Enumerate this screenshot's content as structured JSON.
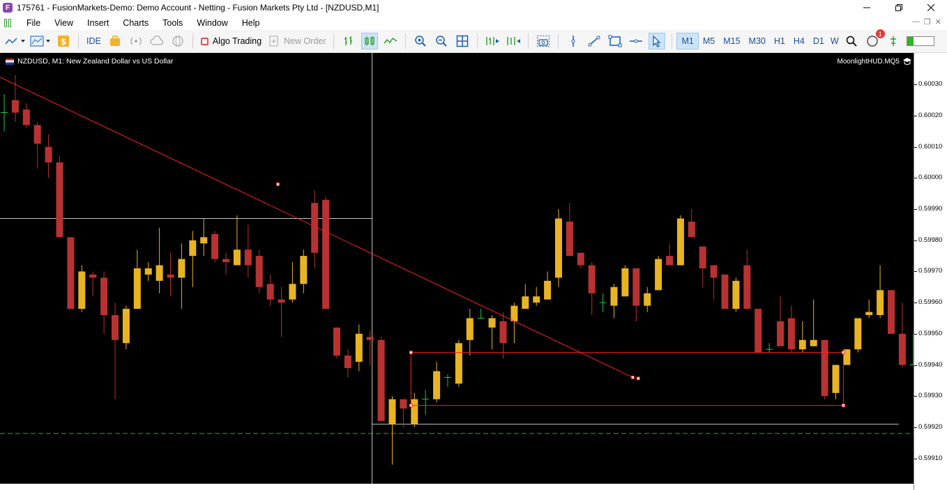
{
  "window": {
    "title": "175761 - FusionMarkets-Demo: Demo Account - Netting - Fusion Markets Pty Ltd - [NZDUSD,M1]",
    "app_icon": "F"
  },
  "menu": [
    "File",
    "View",
    "Insert",
    "Charts",
    "Tools",
    "Window",
    "Help"
  ],
  "toolbar": {
    "ide_label": "IDE",
    "algo_trading_label": "Algo Trading",
    "new_order_label": "New Order",
    "timeframes": [
      "M1",
      "M5",
      "M15",
      "M30",
      "H1",
      "H4",
      "D1",
      "W"
    ],
    "active_timeframe": "M1",
    "notifications": "1",
    "level": 0.25
  },
  "chart": {
    "header": "NZDUSD, M1:  New Zealand Dollar vs US Dollar",
    "indicator": "MoonlightHUD.MQ5",
    "colors": {
      "bull": "#e8b422",
      "bear": "#b83232",
      "doji": "#22c84a",
      "trendline": "#ff2020",
      "bid_line": "#2fa82f",
      "crosshair": "#c8c8c8"
    }
  },
  "chart_data": {
    "type": "candlestick",
    "symbol": "NZDUSD",
    "timeframe": "M1",
    "ylim": [
      0.59905,
      0.60037
    ],
    "y_ticks": [
      "0.60030",
      "0.60020",
      "0.60010",
      "0.60000",
      "0.59990",
      "0.59980",
      "0.59970",
      "0.59960",
      "0.59950",
      "0.59940",
      "0.59930",
      "0.59920",
      "0.59910"
    ],
    "candles": [
      [
        0.60021,
        0.60027,
        0.60015,
        0.60021
      ],
      [
        0.60025,
        0.60033,
        0.60018,
        0.60021
      ],
      [
        0.60022,
        0.60024,
        0.60016,
        0.60017
      ],
      [
        0.60017,
        0.60018,
        0.60003,
        0.60011
      ],
      [
        0.6001,
        0.60014,
        0.6,
        0.60005
      ],
      [
        0.60005,
        0.60007,
        0.59981,
        0.59981
      ],
      [
        0.59981,
        0.59977,
        0.59958,
        0.59958
      ],
      [
        0.59958,
        0.59972,
        0.59957,
        0.5997
      ],
      [
        0.59969,
        0.5997,
        0.59962,
        0.59968
      ],
      [
        0.59968,
        0.5997,
        0.5995,
        0.59956
      ],
      [
        0.59956,
        0.5996,
        0.59929,
        0.59948
      ],
      [
        0.59947,
        0.59959,
        0.59945,
        0.59958
      ],
      [
        0.59958,
        0.59977,
        0.59958,
        0.59971
      ],
      [
        0.59969,
        0.59973,
        0.59967,
        0.59971
      ],
      [
        0.59967,
        0.59984,
        0.59963,
        0.59972
      ],
      [
        0.59969,
        0.59976,
        0.59962,
        0.59968
      ],
      [
        0.59968,
        0.59979,
        0.59958,
        0.59974
      ],
      [
        0.59975,
        0.59983,
        0.59965,
        0.5998
      ],
      [
        0.59979,
        0.59987,
        0.59975,
        0.59981
      ],
      [
        0.59982,
        0.59983,
        0.59973,
        0.59974
      ],
      [
        0.59974,
        0.59976,
        0.59969,
        0.59973
      ],
      [
        0.59972,
        0.59988,
        0.59972,
        0.59977
      ],
      [
        0.59977,
        0.59985,
        0.59968,
        0.59972
      ],
      [
        0.59975,
        0.59977,
        0.59963,
        0.59965
      ],
      [
        0.59966,
        0.59969,
        0.59959,
        0.59961
      ],
      [
        0.59961,
        0.59965,
        0.59949,
        0.5996
      ],
      [
        0.59961,
        0.59973,
        0.5996,
        0.59966
      ],
      [
        0.59966,
        0.59977,
        0.59963,
        0.59975
      ],
      [
        0.59992,
        0.59996,
        0.59971,
        0.59976
      ],
      [
        0.59993,
        0.59994,
        0.59958,
        0.59958
      ],
      [
        0.59952,
        0.59951,
        0.59942,
        0.59943
      ],
      [
        0.59943,
        0.59945,
        0.59936,
        0.59939
      ],
      [
        0.59941,
        0.59953,
        0.59938,
        0.5995
      ],
      [
        0.59949,
        0.59951,
        0.5994,
        0.59948
      ],
      [
        0.59948,
        0.59949,
        0.59922,
        0.59922
      ],
      [
        0.59921,
        0.5993,
        0.59908,
        0.59929
      ],
      [
        0.59929,
        0.59929,
        0.5992,
        0.59926
      ],
      [
        0.59921,
        0.59931,
        0.5992,
        0.59929
      ],
      [
        0.59929,
        0.59932,
        0.59924,
        0.59929
      ],
      [
        0.59929,
        0.59941,
        0.59928,
        0.59938
      ],
      [
        0.59936,
        0.59937,
        0.59933,
        0.59936
      ],
      [
        0.59934,
        0.59948,
        0.59933,
        0.59947
      ],
      [
        0.59948,
        0.59958,
        0.59943,
        0.59955
      ],
      [
        0.59955,
        0.59958,
        0.59955,
        0.59955
      ],
      [
        0.59952,
        0.59956,
        0.59945,
        0.59955
      ],
      [
        0.59954,
        0.59957,
        0.59942,
        0.59947
      ],
      [
        0.59954,
        0.5996,
        0.59947,
        0.59959
      ],
      [
        0.59958,
        0.59966,
        0.59958,
        0.59962
      ],
      [
        0.5996,
        0.59965,
        0.59959,
        0.59962
      ],
      [
        0.59961,
        0.5997,
        0.59961,
        0.59967
      ],
      [
        0.59968,
        0.5999,
        0.59965,
        0.59987
      ],
      [
        0.59986,
        0.59992,
        0.59976,
        0.59975
      ],
      [
        0.59976,
        0.59976,
        0.59971,
        0.59972
      ],
      [
        0.59972,
        0.59973,
        0.59956,
        0.59963
      ],
      [
        0.5996,
        0.59963,
        0.59957,
        0.5996
      ],
      [
        0.59959,
        0.59966,
        0.59955,
        0.59965
      ],
      [
        0.59962,
        0.59972,
        0.59962,
        0.59971
      ],
      [
        0.59971,
        0.59971,
        0.59954,
        0.59959
      ],
      [
        0.59959,
        0.59965,
        0.59957,
        0.59963
      ],
      [
        0.59964,
        0.59975,
        0.59964,
        0.59974
      ],
      [
        0.59975,
        0.59979,
        0.59972,
        0.59972
      ],
      [
        0.59972,
        0.59988,
        0.59972,
        0.59987
      ],
      [
        0.59986,
        0.5999,
        0.59981,
        0.59981
      ],
      [
        0.59978,
        0.59978,
        0.59965,
        0.59971
      ],
      [
        0.59972,
        0.59972,
        0.59961,
        0.59968
      ],
      [
        0.59969,
        0.59969,
        0.59958,
        0.59958
      ],
      [
        0.59958,
        0.59968,
        0.59957,
        0.59967
      ],
      [
        0.59972,
        0.59977,
        0.59958,
        0.59958
      ],
      [
        0.59958,
        0.59958,
        0.59944,
        0.59944
      ],
      [
        0.59945,
        0.59947,
        0.59944,
        0.59945
      ],
      [
        0.59954,
        0.59962,
        0.59947,
        0.59946
      ],
      [
        0.59955,
        0.59959,
        0.59944,
        0.59945
      ],
      [
        0.59945,
        0.59954,
        0.59944,
        0.59948
      ],
      [
        0.59946,
        0.59961,
        0.59946,
        0.59948
      ],
      [
        0.59948,
        0.59948,
        0.59929,
        0.5993
      ],
      [
        0.59931,
        0.5994,
        0.59929,
        0.5994
      ],
      [
        0.5994,
        0.59945,
        0.5994,
        0.59945
      ],
      [
        0.59945,
        0.59955,
        0.59944,
        0.59955
      ],
      [
        0.59956,
        0.59961,
        0.59955,
        0.59957
      ],
      [
        0.59956,
        0.59972,
        0.59955,
        0.59964
      ],
      [
        0.59964,
        0.59964,
        0.5995,
        0.5995
      ],
      [
        0.5995,
        0.5996,
        0.59939,
        0.5994
      ],
      [
        0.5994,
        0.5995,
        0.5994,
        0.5994
      ]
    ],
    "annotations": {
      "trendline": [
        [
          -4,
          0.60039
        ],
        [
          25,
          0.59998
        ],
        [
          57,
          0.59936
        ]
      ],
      "rectangle": {
        "x": [
          37,
          76
        ],
        "y": [
          0.59927,
          0.59944
        ]
      },
      "crosshair": {
        "x": 33.5,
        "y": 0.59987
      },
      "bid_line": 0.59918,
      "support_line": {
        "x": [
          33.5,
          81
        ],
        "y": 0.59921
      }
    }
  }
}
